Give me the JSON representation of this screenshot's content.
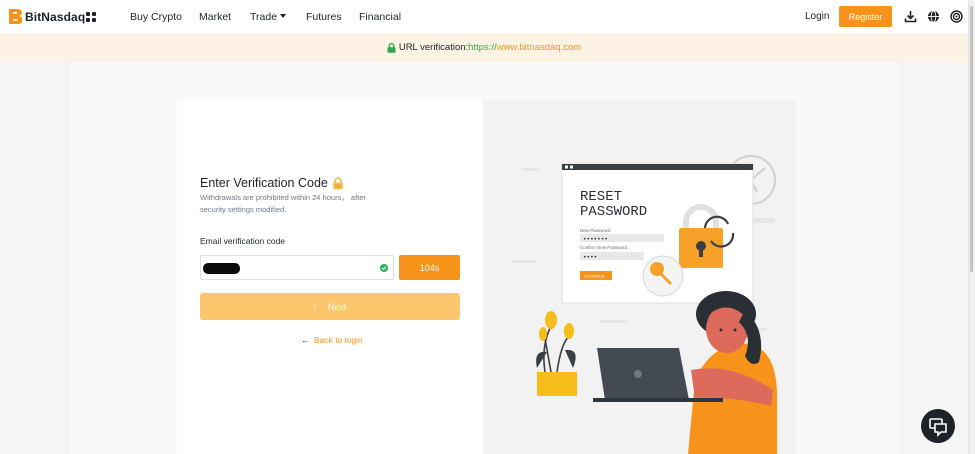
{
  "header": {
    "logo_text": "BitNasdaq",
    "nav_items": [
      {
        "label": "Buy Crypto"
      },
      {
        "label": "Market"
      },
      {
        "label": "Trade"
      },
      {
        "label": "Futures"
      },
      {
        "label": "Financial"
      }
    ],
    "login_label": "Login",
    "register_label": "Register",
    "icons": [
      "download-icon",
      "globe-icon",
      "user-account-icon"
    ]
  },
  "banner": {
    "label": "URL verification:",
    "protocol": "https://",
    "domain": "www.bitnasdaq.com"
  },
  "form": {
    "title": "Enter Verification Code",
    "subtitle": "Withdrawals are prohibited within 24 hours， after security settings modified.",
    "field_label": "Email verification code",
    "countdown": "104s",
    "next_label": "Next",
    "back_label": "Back to login"
  },
  "illustration": {
    "heading_line1": "RESET",
    "heading_line2": "PASSWORD",
    "new_password_label": "New Password",
    "confirm_password_label": "Confirm New Password",
    "new_password_mask": "•••••••",
    "confirm_password_mask": "••••",
    "continue_label": "CONTINUE"
  },
  "colors": {
    "brand": "#f7931a",
    "banner_bg": "#fdf3e4",
    "next_disabled": "#fdc66c",
    "success": "#31b45c",
    "https_green": "#2fa94e"
  }
}
